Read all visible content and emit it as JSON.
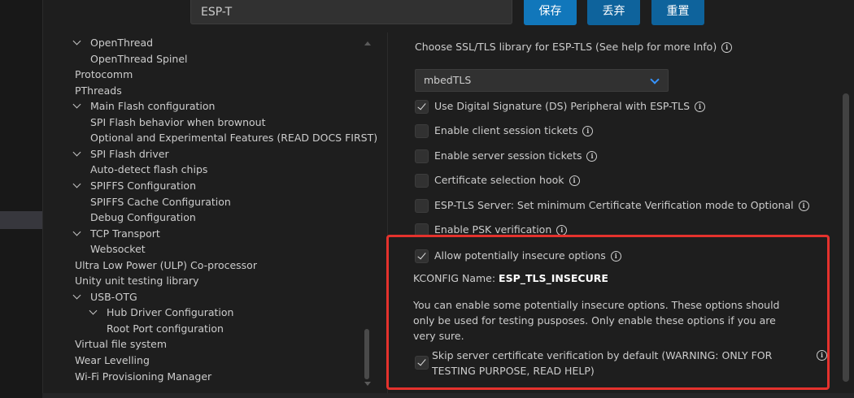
{
  "search": {
    "value": "ESP-T"
  },
  "buttons": {
    "save": "保存",
    "discard": "丢弃",
    "reset": "重置"
  },
  "tree": [
    {
      "label": "OpenThread",
      "chevron": true
    },
    {
      "label": "OpenThread Spinel",
      "chevron": false
    },
    {
      "label": "Protocomm",
      "chevron": false
    },
    {
      "label": "PThreads",
      "chevron": false
    },
    {
      "label": "Main Flash configuration",
      "chevron": true
    },
    {
      "label": "SPI Flash behavior when brownout",
      "chevron": false
    },
    {
      "label": "Optional and Experimental Features (READ DOCS FIRST)",
      "chevron": false
    },
    {
      "label": "SPI Flash driver",
      "chevron": true
    },
    {
      "label": "Auto-detect flash chips",
      "chevron": false
    },
    {
      "label": "SPIFFS Configuration",
      "chevron": true
    },
    {
      "label": "SPIFFS Cache Configuration",
      "chevron": false
    },
    {
      "label": "Debug Configuration",
      "chevron": false
    },
    {
      "label": "TCP Transport",
      "chevron": true
    },
    {
      "label": "Websocket",
      "chevron": false
    },
    {
      "label": "Ultra Low Power (ULP) Co-processor",
      "chevron": false
    },
    {
      "label": "Unity unit testing library",
      "chevron": false
    },
    {
      "label": "USB-OTG",
      "chevron": true
    },
    {
      "label": "Hub Driver Configuration",
      "chevron": true
    },
    {
      "label": "Root Port configuration",
      "chevron": false
    },
    {
      "label": "Virtual file system",
      "chevron": false
    },
    {
      "label": "Wear Levelling",
      "chevron": false
    },
    {
      "label": "Wi-Fi Provisioning Manager",
      "chevron": false
    }
  ],
  "settings": {
    "heading": "Choose SSL/TLS library for ESP-TLS (See help for more Info)",
    "select_value": "mbedTLS",
    "options": [
      {
        "label": "Use Digital Signature (DS) Peripheral with ESP-TLS",
        "checked": true
      },
      {
        "label": "Enable client session tickets",
        "checked": false
      },
      {
        "label": "Enable server session tickets",
        "checked": false
      },
      {
        "label": "Certificate selection hook",
        "checked": false
      },
      {
        "label": "ESP-TLS Server: Set minimum Certificate Verification mode to Optional",
        "checked": false
      },
      {
        "label": "Enable PSK verification",
        "checked": false
      }
    ],
    "insecure": {
      "label": "Allow potentially insecure options",
      "checked": true,
      "kconfig_prefix": "KCONFIG Name:",
      "kconfig_name": "ESP_TLS_INSECURE",
      "description": "You can enable some potentially insecure options. These options should only be used for testing pusposes. Only enable these options if you are very sure.",
      "skip_label": "Skip server certificate verification by default (WARNING: ONLY FOR TESTING PURPOSE, READ HELP)",
      "skip_checked": true
    }
  },
  "colors": {
    "accent": "#0e639c",
    "highlight_box": "#e5322d",
    "background": "#1e1e1e"
  },
  "icons": {
    "info": "info-circle-icon",
    "chevron": "chevron-down-icon",
    "select_caret": "chevron-down-icon"
  }
}
